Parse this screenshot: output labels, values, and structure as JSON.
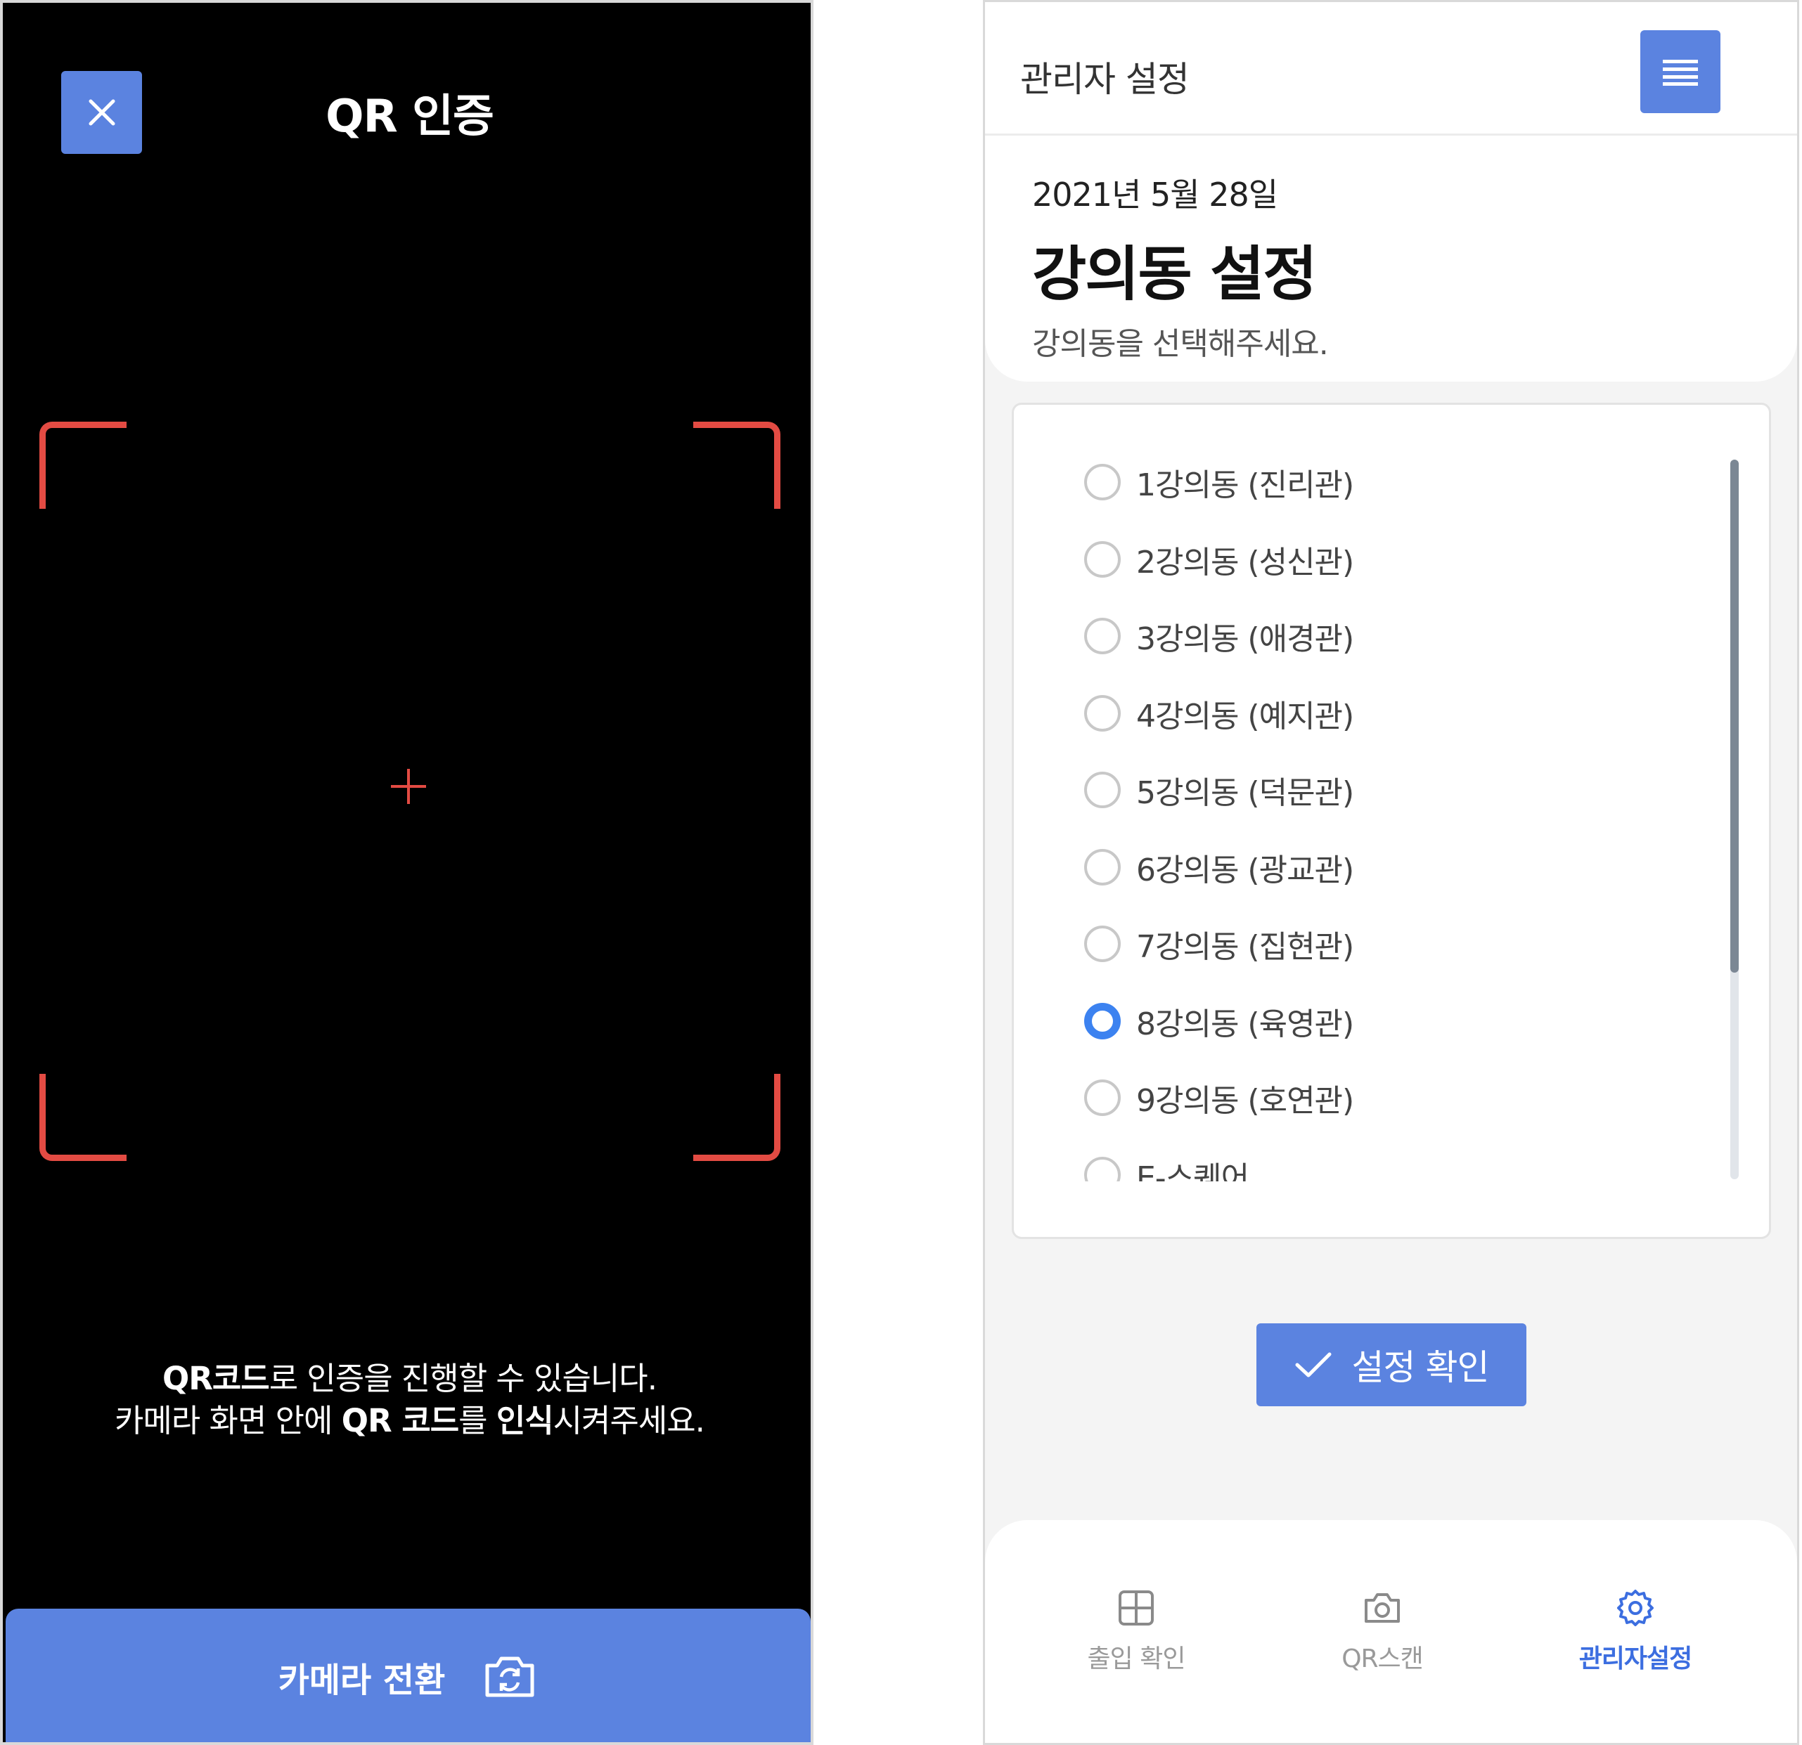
{
  "qr_screen": {
    "title": "QR 인증",
    "guide": {
      "line1_bold": "QR코드",
      "line1_rest": "로 인증을 진행할 수 있습니다.",
      "line2_part1": "카메라 화면 안에 ",
      "line2_bold1": "QR 코드",
      "line2_part2": "를 ",
      "line2_bold2": "인식",
      "line2_part3": "시켜주세요."
    },
    "camera_switch_label": "카메라 전환",
    "close_icon": "close-icon",
    "scan_frame_color": "#e34b43",
    "accent_color": "#5b83e0"
  },
  "admin_screen": {
    "header_title": "관리자 설정",
    "date": "2021년 5월 28일",
    "section_title": "강의동 설정",
    "section_subtitle": "강의동을 선택해주세요.",
    "buildings": [
      {
        "label": "1강의동 (진리관)",
        "selected": false
      },
      {
        "label": "2강의동 (성신관)",
        "selected": false
      },
      {
        "label": "3강의동 (애경관)",
        "selected": false
      },
      {
        "label": "4강의동 (예지관)",
        "selected": false
      },
      {
        "label": "5강의동 (덕문관)",
        "selected": false
      },
      {
        "label": "6강의동 (광교관)",
        "selected": false
      },
      {
        "label": "7강의동 (집현관)",
        "selected": false
      },
      {
        "label": "8강의동 (육영관)",
        "selected": true
      },
      {
        "label": "9강의동 (호연관)",
        "selected": false
      },
      {
        "label": "E-스퀘어",
        "selected": false
      }
    ],
    "confirm_label": "설정 확인",
    "bottom_nav": [
      {
        "label": "출입 확인",
        "icon": "grid-icon",
        "active": false
      },
      {
        "label": "QR스캔",
        "icon": "camera-icon",
        "active": false
      },
      {
        "label": "관리자설정",
        "icon": "gear-icon",
        "active": true
      }
    ],
    "selected_color": "#3c82f0"
  }
}
